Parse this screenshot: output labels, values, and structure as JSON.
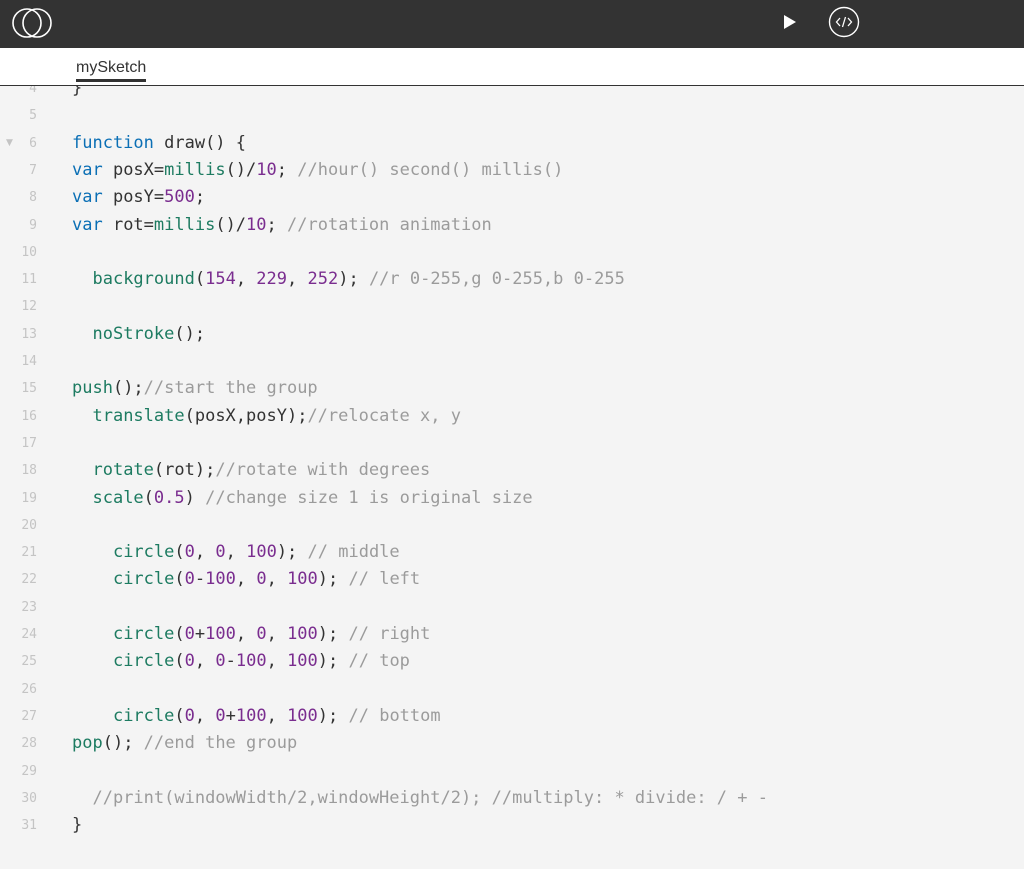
{
  "app": {
    "tab_label": "mySketch",
    "icons": {
      "logo": "openprocessing-logo-icon",
      "play": "play-icon",
      "embed": "code-embed-icon",
      "fold": "fold-arrow-icon"
    }
  },
  "colors": {
    "topbar": "#333333",
    "editor_bg": "#f4f4f4",
    "keyword": "#0b6fb5",
    "function": "#1d7b61",
    "number": "#7a2d8f",
    "comment": "#9b9b9b",
    "gutter": "#c4c4c4"
  },
  "editor": {
    "lines": [
      {
        "num": "4",
        "tokens": [
          {
            "t": "}",
            "c": "pl"
          }
        ]
      },
      {
        "num": "5",
        "tokens": []
      },
      {
        "num": "6",
        "fold": true,
        "tokens": [
          {
            "t": "function",
            "c": "kw"
          },
          {
            "t": " draw() {",
            "c": "pl"
          }
        ]
      },
      {
        "num": "7",
        "tokens": [
          {
            "t": "var",
            "c": "kw"
          },
          {
            "t": " posX=",
            "c": "pl"
          },
          {
            "t": "millis",
            "c": "fn"
          },
          {
            "t": "()/",
            "c": "pl"
          },
          {
            "t": "10",
            "c": "num"
          },
          {
            "t": "; ",
            "c": "pl"
          },
          {
            "t": "//hour() second() millis()",
            "c": "cm"
          }
        ]
      },
      {
        "num": "8",
        "tokens": [
          {
            "t": "var",
            "c": "kw"
          },
          {
            "t": " posY=",
            "c": "pl"
          },
          {
            "t": "500",
            "c": "num"
          },
          {
            "t": ";",
            "c": "pl"
          }
        ]
      },
      {
        "num": "9",
        "tokens": [
          {
            "t": "var",
            "c": "kw"
          },
          {
            "t": " rot=",
            "c": "pl"
          },
          {
            "t": "millis",
            "c": "fn"
          },
          {
            "t": "()/",
            "c": "pl"
          },
          {
            "t": "10",
            "c": "num"
          },
          {
            "t": "; ",
            "c": "pl"
          },
          {
            "t": "//rotation animation",
            "c": "cm"
          }
        ]
      },
      {
        "num": "10",
        "tokens": []
      },
      {
        "num": "11",
        "tokens": [
          {
            "t": "  ",
            "c": "pl"
          },
          {
            "t": "background",
            "c": "fn"
          },
          {
            "t": "(",
            "c": "pl"
          },
          {
            "t": "154",
            "c": "num"
          },
          {
            "t": ", ",
            "c": "pl"
          },
          {
            "t": "229",
            "c": "num"
          },
          {
            "t": ", ",
            "c": "pl"
          },
          {
            "t": "252",
            "c": "num"
          },
          {
            "t": "); ",
            "c": "pl"
          },
          {
            "t": "//r 0-255,g 0-255,b 0-255",
            "c": "cm"
          }
        ]
      },
      {
        "num": "12",
        "tokens": []
      },
      {
        "num": "13",
        "tokens": [
          {
            "t": "  ",
            "c": "pl"
          },
          {
            "t": "noStroke",
            "c": "fn"
          },
          {
            "t": "();",
            "c": "pl"
          }
        ]
      },
      {
        "num": "14",
        "tokens": []
      },
      {
        "num": "15",
        "tokens": [
          {
            "t": "push",
            "c": "fn"
          },
          {
            "t": "();",
            "c": "pl"
          },
          {
            "t": "//start the group",
            "c": "cm"
          }
        ]
      },
      {
        "num": "16",
        "tokens": [
          {
            "t": "  ",
            "c": "pl"
          },
          {
            "t": "translate",
            "c": "fn"
          },
          {
            "t": "(posX,posY);",
            "c": "pl"
          },
          {
            "t": "//relocate x, y",
            "c": "cm"
          }
        ]
      },
      {
        "num": "17",
        "tokens": []
      },
      {
        "num": "18",
        "tokens": [
          {
            "t": "  ",
            "c": "pl"
          },
          {
            "t": "rotate",
            "c": "fn"
          },
          {
            "t": "(rot);",
            "c": "pl"
          },
          {
            "t": "//rotate with degrees",
            "c": "cm"
          }
        ]
      },
      {
        "num": "19",
        "tokens": [
          {
            "t": "  ",
            "c": "pl"
          },
          {
            "t": "scale",
            "c": "fn"
          },
          {
            "t": "(",
            "c": "pl"
          },
          {
            "t": "0.5",
            "c": "num"
          },
          {
            "t": ") ",
            "c": "pl"
          },
          {
            "t": "//change size 1 is original size",
            "c": "cm"
          }
        ]
      },
      {
        "num": "20",
        "tokens": []
      },
      {
        "num": "21",
        "tokens": [
          {
            "t": "    ",
            "c": "pl"
          },
          {
            "t": "circle",
            "c": "fn"
          },
          {
            "t": "(",
            "c": "pl"
          },
          {
            "t": "0",
            "c": "num"
          },
          {
            "t": ", ",
            "c": "pl"
          },
          {
            "t": "0",
            "c": "num"
          },
          {
            "t": ", ",
            "c": "pl"
          },
          {
            "t": "100",
            "c": "num"
          },
          {
            "t": "); ",
            "c": "pl"
          },
          {
            "t": "// middle",
            "c": "cm"
          }
        ]
      },
      {
        "num": "22",
        "tokens": [
          {
            "t": "    ",
            "c": "pl"
          },
          {
            "t": "circle",
            "c": "fn"
          },
          {
            "t": "(",
            "c": "pl"
          },
          {
            "t": "0",
            "c": "num"
          },
          {
            "t": "-",
            "c": "pl"
          },
          {
            "t": "100",
            "c": "num"
          },
          {
            "t": ", ",
            "c": "pl"
          },
          {
            "t": "0",
            "c": "num"
          },
          {
            "t": ", ",
            "c": "pl"
          },
          {
            "t": "100",
            "c": "num"
          },
          {
            "t": "); ",
            "c": "pl"
          },
          {
            "t": "// left",
            "c": "cm"
          }
        ]
      },
      {
        "num": "23",
        "tokens": []
      },
      {
        "num": "24",
        "tokens": [
          {
            "t": "    ",
            "c": "pl"
          },
          {
            "t": "circle",
            "c": "fn"
          },
          {
            "t": "(",
            "c": "pl"
          },
          {
            "t": "0",
            "c": "num"
          },
          {
            "t": "+",
            "c": "pl"
          },
          {
            "t": "100",
            "c": "num"
          },
          {
            "t": ", ",
            "c": "pl"
          },
          {
            "t": "0",
            "c": "num"
          },
          {
            "t": ", ",
            "c": "pl"
          },
          {
            "t": "100",
            "c": "num"
          },
          {
            "t": "); ",
            "c": "pl"
          },
          {
            "t": "// right",
            "c": "cm"
          }
        ]
      },
      {
        "num": "25",
        "tokens": [
          {
            "t": "    ",
            "c": "pl"
          },
          {
            "t": "circle",
            "c": "fn"
          },
          {
            "t": "(",
            "c": "pl"
          },
          {
            "t": "0",
            "c": "num"
          },
          {
            "t": ", ",
            "c": "pl"
          },
          {
            "t": "0",
            "c": "num"
          },
          {
            "t": "-",
            "c": "pl"
          },
          {
            "t": "100",
            "c": "num"
          },
          {
            "t": ", ",
            "c": "pl"
          },
          {
            "t": "100",
            "c": "num"
          },
          {
            "t": "); ",
            "c": "pl"
          },
          {
            "t": "// top",
            "c": "cm"
          }
        ]
      },
      {
        "num": "26",
        "tokens": []
      },
      {
        "num": "27",
        "tokens": [
          {
            "t": "    ",
            "c": "pl"
          },
          {
            "t": "circle",
            "c": "fn"
          },
          {
            "t": "(",
            "c": "pl"
          },
          {
            "t": "0",
            "c": "num"
          },
          {
            "t": ", ",
            "c": "pl"
          },
          {
            "t": "0",
            "c": "num"
          },
          {
            "t": "+",
            "c": "pl"
          },
          {
            "t": "100",
            "c": "num"
          },
          {
            "t": ", ",
            "c": "pl"
          },
          {
            "t": "100",
            "c": "num"
          },
          {
            "t": "); ",
            "c": "pl"
          },
          {
            "t": "// bottom",
            "c": "cm"
          }
        ]
      },
      {
        "num": "28",
        "tokens": [
          {
            "t": "pop",
            "c": "fn"
          },
          {
            "t": "(); ",
            "c": "pl"
          },
          {
            "t": "//end the group",
            "c": "cm"
          }
        ]
      },
      {
        "num": "29",
        "tokens": []
      },
      {
        "num": "30",
        "tokens": [
          {
            "t": "  ",
            "c": "pl"
          },
          {
            "t": "//print(windowWidth/2,windowHeight/2); //multiply: * divide: / + -",
            "c": "cm"
          }
        ]
      },
      {
        "num": "31",
        "tokens": [
          {
            "t": "}",
            "c": "pl"
          }
        ]
      }
    ]
  }
}
